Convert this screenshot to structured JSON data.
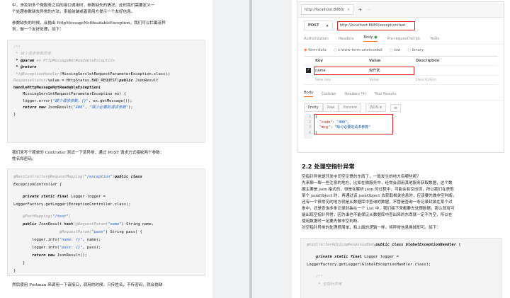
{
  "left": {
    "para1_line1": "中，涉及到多个微服务之间的接口调用时，参数缺失的情况，此时我们需要定义一",
    "para1_line2": "个处理参数缺失异常的方法，来给前端或者调用方提示一个友好信息。",
    "para2_line1": "参数缺失的时候，会抛出 HttpMessageNotReadableException，我们可以拦截该异",
    "para2_line2": "常，做一个友好处理，如下：",
    "code1": {
      "l1": "/**",
      "l2": " * 缺少请求参数异常",
      "l3_tag": " * @param",
      "l3_rest": " ex HttpMessageNotReadableException",
      "l4_tag": " * @return",
      "l5_cm": " */@ExceptionHandler(",
      "l5_rest": "MissingServletRequestParameterException.class)",
      "l5_end": "@",
      "l6_cm": "ResponseStatus(",
      "l6_rest": "value = HttpStatus.BAD_REQUEST)",
      "l6_kw": "public",
      "l6_it": " JsonResult",
      "l7": "handleHttpMessageNotReadableException(",
      "l8": "    MissingServletRequestParameterException ex) {",
      "l9_a": "    logger.error(",
      "l9_st": "\"缺少请求参数，{}\"",
      "l9_b": ", ex.getMessage());",
      "l10_kw": "    return new",
      "l10_a": " JsonResult(",
      "l10_st1": "\"400\"",
      "l10_st2": "\"缺少必要的请求参数\"",
      "l10_b": ");",
      "l11": "}"
    },
    "para3_line1": "我们来写个简单的 Controller 测试一下该异常，通过 POST 请求方式接收两个参数：",
    "para3_line2": "姓名和密码。",
    "code2": {
      "l1_an": "@RestController@RequestMapping(",
      "l1_st": "\"/exception\"",
      "l1_an2": ")",
      "l1_kw": "public class",
      "l2": "ExceptionController {",
      "l3_kw": "    private static final",
      "l3_a": " Logger logger =",
      "l4": "LoggerFactory.getLogger(ExceptionController.class);",
      "l5_an": "    @PostMapping(",
      "l5_st": "\"/test\"",
      "l5_an2": ")",
      "l6_kw": "    public",
      "l6_it": " JsonResult",
      "l6_bk": " test",
      "l6_an": "(@RequestParam(",
      "l6_st": "\"name\"",
      "l6_b": ") String name,",
      "l7_an": "                    @RequestParam(",
      "l7_st": "\"pass\"",
      "l7_b": ") String pass) {",
      "l8_a": "        logger.info(",
      "l8_st": "\"name: {}\"",
      "l8_b": ", name);",
      "l9_a": "        logger.info(",
      "l9_st": "\"pass: {}\"",
      "l9_b": ", pass);",
      "l10_kw": "        return new",
      "l10_a": " JsonResult();",
      "l11": "    }",
      "l12": "}"
    },
    "para4": "然后使用 Postman 来调用一下该接口，调用的时候，只传姓名，不传密码，就会抛缺"
  },
  "right": {
    "postman": {
      "tab_url": "http://localhost:8080/",
      "tab_close": "×",
      "new_tab": "+",
      "more": "···",
      "method": "POST",
      "url": "http://localhost:8080/exception/test",
      "req_tabs": [
        "Authorization",
        "Headers",
        "Body",
        "Pre-request Script",
        "Tests"
      ],
      "body_types": [
        "form-data",
        "x-www-form-urlencoded",
        "raw",
        "binary"
      ],
      "col_key": "Key",
      "col_value": "Value",
      "col_desc": "Description",
      "row_key": "name",
      "row_value": "倪升武",
      "new_key": "New key",
      "new_value": "Value",
      "new_desc": "Description",
      "resp_tabs": [
        "Body",
        "Cookies",
        "Headers (4)",
        "Test Results"
      ],
      "fmt_buttons": [
        "Pretty",
        "Raw",
        "Preview"
      ],
      "fmt_select": "JSON",
      "json_l1": "{",
      "json_l2_key": "\"code\"",
      "json_l2_val": "\"400\",",
      "json_l3_key": "\"msg\"",
      "json_l3_val": "\"缺少必要的请求参数\"",
      "json_l4": "}"
    },
    "section_title": "2.2 处理空指针异常",
    "para_lines": [
      "空指针异常是开发中司空见惯的东西了，一般发生的地方有哪些呢？",
      "先来聊一聊一些注意的地方，比如在微服务中，经常会调用其他服务获取数据，这个数",
      "据主要是 json 格式的，但是在解析 json 的过程中，可能会有空出现，所以我们在获取",
      "某个 jsonObject 时，再通过该 jsonObject 去获取相关信息时，应该要先做非空判断。",
      "还有一个很常见的地方就是从数据库中查询的数据，不管是查询一条记录封装在某个对",
      "象中，还是查询多条记录封装在一个 List 中，我们接下来都要去处理数据，那么就有可",
      "能出现空指针异常，因为谁也不能保证从数据库中查出来的东西就一定不为空，所以在",
      "使用数据时一定要先做非空判断。",
      "对空指针异常的处理很简单，和上面的逻辑一样，将异常信息换掉即可。如下："
    ],
    "code3": {
      "l1_an": "@ControllerAdvice@ResponseBody",
      "l1_kw": "public class",
      "l1_it": " GlobalExceptionHandler",
      "l1_b": " {",
      "l2_kw": "    private static final",
      "l2_a": " Logger logger =",
      "l3": "LoggerFactory.getLogger(GlobalExceptionHandler.class);",
      "l4": "    /**",
      "l5": "     * 空指针异常"
    }
  }
}
